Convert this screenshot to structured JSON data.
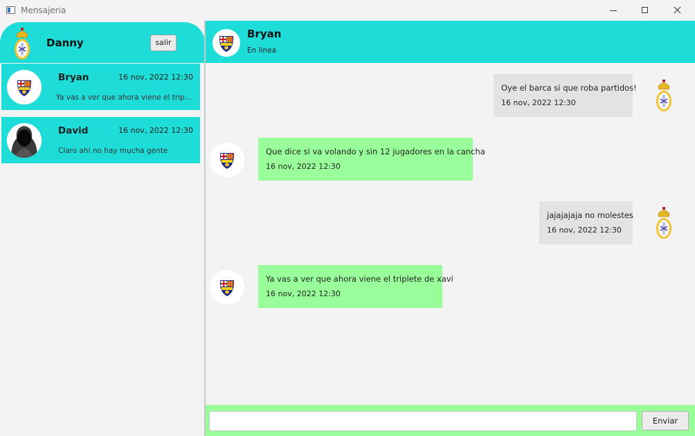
{
  "window": {
    "title": "Mensajeria"
  },
  "user": {
    "name": "Danny",
    "logout_label": "salir",
    "avatar_icon": "real-madrid-crest-icon"
  },
  "contacts": [
    {
      "name": "Bryan",
      "time": "16 nov, 2022  12:30",
      "last_message": "Ya vas a ver que ahora viene el triplete de xavi",
      "avatar_icon": "barcelona-crest-icon"
    },
    {
      "name": "David",
      "time": "16 nov, 2022  12:30",
      "last_message": "Claro ahi no hay mucha gente",
      "avatar_icon": "hooded-person-icon"
    }
  ],
  "chat": {
    "name": "Bryan",
    "status": "En linea",
    "messages": [
      {
        "direction": "sent",
        "text": "Oye el barca si que roba partidos!",
        "time": "16 nov, 2022  12:30"
      },
      {
        "direction": "received",
        "text": "Que dice si va volando y sin 12 jugadores en la cancha",
        "time": "16 nov, 2022  12:30"
      },
      {
        "direction": "sent",
        "text": "jajajajaja no molestes",
        "time": "16 nov, 2022  12:30"
      },
      {
        "direction": "received",
        "text": "Ya vas a ver que ahora viene el triplete de xavi",
        "time": "16 nov, 2022  12:30"
      }
    ]
  },
  "composer": {
    "value": "",
    "placeholder": "",
    "send_label": "Enviar"
  },
  "colors": {
    "accent": "#1edcd8",
    "received_bubble": "#99fe9a",
    "sent_bubble": "#e3e3e3",
    "background": "#f3f3f3"
  }
}
